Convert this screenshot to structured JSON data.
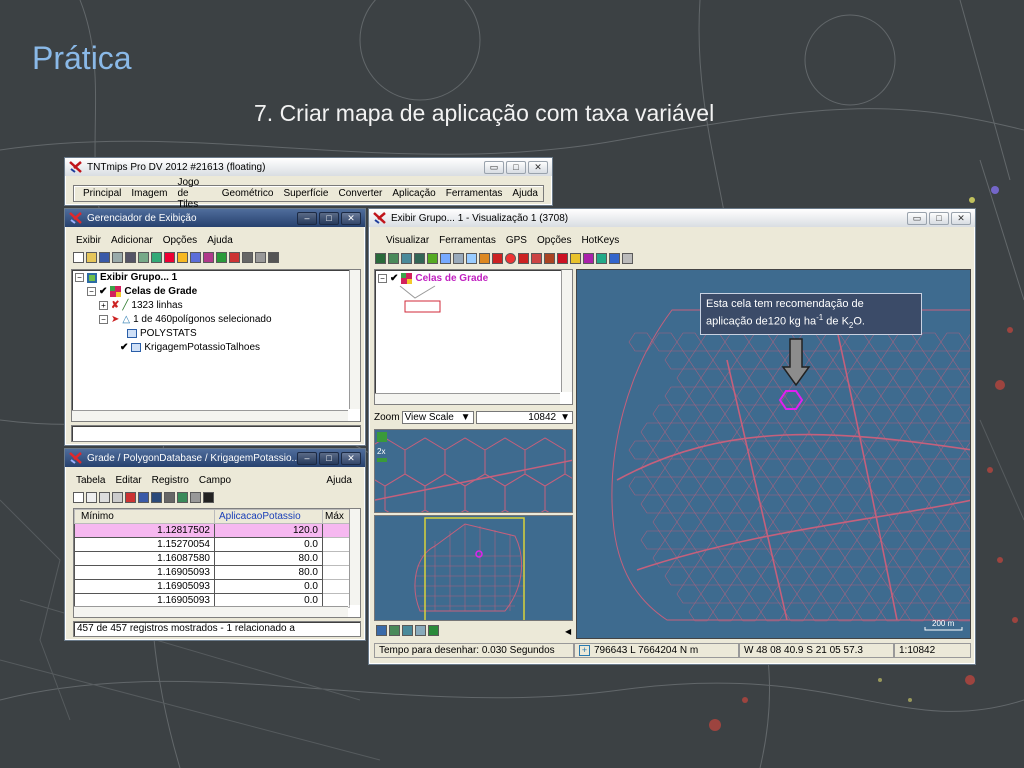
{
  "slide": {
    "title": "Prática",
    "subtitle": "7. Criar mapa de aplicação com taxa variável"
  },
  "main_window": {
    "title": "TNTmips Pro DV 2012  #21613 (floating)",
    "menu": [
      "Principal",
      "Imagem",
      "Jogo de Tiles",
      "Geométrico",
      "Superfície",
      "Converter",
      "Aplicação",
      "Ferramentas",
      "Ajuda"
    ]
  },
  "display_manager": {
    "title": "Gerenciador de Exibição",
    "menu": [
      "Exibir",
      "Adicionar",
      "Opções",
      "Ajuda"
    ],
    "tree": {
      "group": "Exibir Grupo... 1",
      "layer": "Celas de Grade",
      "lines": "1323 linhas",
      "polygons": "1 de 460polígonos selecionado",
      "table1": "POLYSTATS",
      "table2": "KrigagemPotassioTalhoes"
    }
  },
  "table_window": {
    "title": "Grade / PolygonDatabase / KrigagemPotassio...",
    "menu": [
      "Tabela",
      "Editar",
      "Registro",
      "Campo"
    ],
    "help": "Ajuda",
    "columns": [
      "Mínimo",
      "AplicacaoPotassio",
      "Máx"
    ],
    "rows": [
      [
        "1.12817502",
        "120.0"
      ],
      [
        "1.15270054",
        "0.0"
      ],
      [
        "1.16087580",
        "80.0"
      ],
      [
        "1.16905093",
        "80.0"
      ],
      [
        "1.16905093",
        "0.0"
      ],
      [
        "1.16905093",
        "0.0"
      ]
    ],
    "status": "457 de 457 registros mostrados - 1 relacionado a"
  },
  "view_window": {
    "title": "Exibir Grupo... 1 - Visualização 1 (3708)",
    "menu": [
      "Visualizar",
      "Ferramentas",
      "GPS",
      "Opções",
      "HotKeys"
    ],
    "legend_layer": "Celas de Grade",
    "zoom_label": "Zoom",
    "zoom_mode": "View Scale",
    "zoom_value": "10842",
    "zoom_level": "2x",
    "scale_bar": "200 m",
    "status": {
      "draw_time": "Tempo para desenhar: 0.030 Segundos",
      "coords": "796643 L  7664204 N m",
      "latlon": "W 48 08 40.9  S 21 05 57.3",
      "scale": "1:10842"
    }
  },
  "callout": {
    "line1": "Esta cela tem recomendação de",
    "line2_pre": "aplicação de120 kg ha",
    "sup": "-1",
    "line2_mid": " de K",
    "sub": "2",
    "line2_post": "O."
  },
  "colors": {
    "title_blue": "#8ab9e8",
    "map_blue": "#3e6b8f",
    "polygon_red": "#c5607c",
    "selected_magenta": "#e020f0",
    "row_highlight": "#f6b8f0"
  },
  "icons": [
    "tntmips-app-icon",
    "checkmark-icon",
    "arrow-down-icon",
    "scale-bar"
  ]
}
